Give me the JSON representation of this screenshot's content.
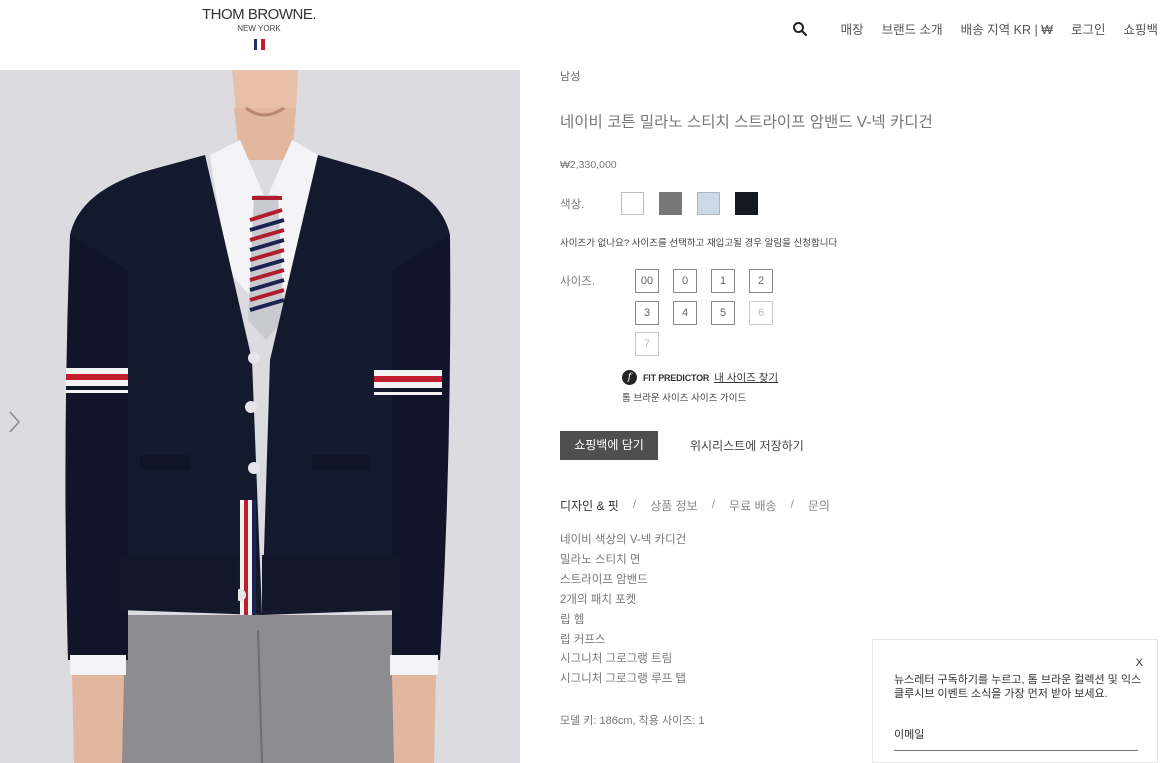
{
  "header": {
    "logo_main": "THOM BROWNE.",
    "logo_sub": "NEW YORK",
    "nav": [
      "매장",
      "브랜드 소개",
      "배송 지역 KR | ₩",
      "로그인",
      "쇼핑백"
    ],
    "search_icon": "search-icon"
  },
  "colors": {
    "flag": [
      "#1c2e66",
      "#ffffff",
      "#c8192e"
    ],
    "cardigan": "#141a2e",
    "button": "#4f4f4f"
  },
  "product": {
    "category": "남성",
    "title": "네이비 코튼 밀라노 스티치 스트라이프 암밴드 V-넥 카디건",
    "price": "₩2,330,000",
    "color_label": "색상.",
    "swatches": [
      {
        "color": "#ffffff",
        "border": "#bbbbbb"
      },
      {
        "color": "#777777",
        "border": "#777777"
      },
      {
        "color": "#cdd9e6",
        "border": "#aab6c4"
      },
      {
        "color": "#141821",
        "border": "#141821"
      }
    ],
    "size_notice": "사이즈가 없나요? 사이즈를 선택하고 재입고될 경우 알림을 신청합니다",
    "size_label": "사이즈.",
    "sizes": [
      {
        "label": "00",
        "available": true
      },
      {
        "label": "0",
        "available": true
      },
      {
        "label": "1",
        "available": true
      },
      {
        "label": "2",
        "available": true
      },
      {
        "label": "3",
        "available": true
      },
      {
        "label": "4",
        "available": true
      },
      {
        "label": "5",
        "available": true
      },
      {
        "label": "6",
        "available": false
      },
      {
        "label": "7",
        "available": false
      }
    ],
    "fit_predictor": "FIT PREDICTOR",
    "fit_link": "내 사이즈 찾기",
    "size_guide": "톰 브라운 사이즈 사이즈 가이드",
    "add_to_bag": "쇼핑백에 담기",
    "wishlist": "위시리스트에 저장하기",
    "tabs": [
      "디자인 & 핏",
      "상품 정보",
      "무료 배송",
      "문의"
    ],
    "description": [
      "네이비 색상의 V-넥 카디건",
      "밀라노 스티치 면",
      "스트라이프 암밴드",
      "2개의 패치 포켓",
      "립 헴",
      "립 커프스",
      "시그니처 그로그랭 트림",
      "시그니처 그로그랭 루프 탭"
    ],
    "model_info": "모델 키: 186cm, 착용 사이즈: 1"
  },
  "newsletter": {
    "close": "X",
    "text": "뉴스레터 구독하기를 누르고, 톰 브라운 컬렉션 및 익스클루시브 이벤트 소식을 가장 먼저 받아 보세요.",
    "email_placeholder": "이메일"
  }
}
